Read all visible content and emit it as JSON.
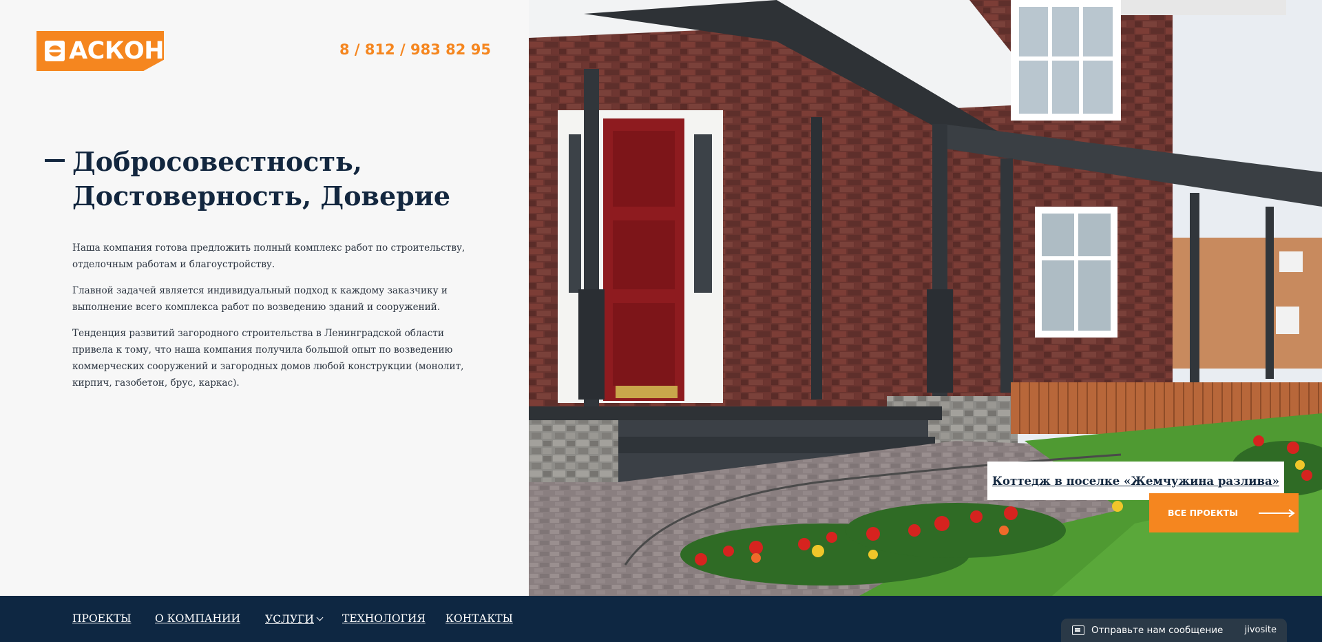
{
  "brand": {
    "logo_text": "АСКОН",
    "phone": "8 / 812 / 983 82 95",
    "accent_color": "#f5861f",
    "navy_color": "#0e2742"
  },
  "hero": {
    "heading_line1": "Добросовестность,",
    "heading_line2": "Достоверность, Доверие",
    "paragraphs": [
      "Наша компания готова предложить полный комплекс работ по строительству, отделочным работам и благоустройству.",
      "Главной задачей является индивидуальный подход к каждому заказчику и выполнение всего комплекса работ по возведению зданий и сооружений.",
      "Тенденция развитий загородного строительства в Ленинградской области привела к тому, что наша компания получила большой опыт по возведению коммерческих сооружений и загородных домов любой конструкции (монолит, кирпич, газобетон, брус, каркас)."
    ]
  },
  "project": {
    "caption": "Коттедж в поселке «Жемчужина разлива»",
    "all_projects_label": "ВСЕ ПРОЕКТЫ",
    "image_icon": "brick-house-with-red-door-photo",
    "arrow_icon": "arrow-right-icon"
  },
  "nav": {
    "items": [
      {
        "label": "ПРОЕКТЫ"
      },
      {
        "label": "О КОМПАНИИ"
      },
      {
        "label": "УСЛУГИ",
        "has_dropdown": true
      },
      {
        "label": "ТЕХНОЛОГИЯ"
      },
      {
        "label": "КОНТАКТЫ"
      }
    ]
  },
  "chat": {
    "label": "Отправьте нам сообщение",
    "brand": "jivosite",
    "icon": "envelope-icon"
  }
}
